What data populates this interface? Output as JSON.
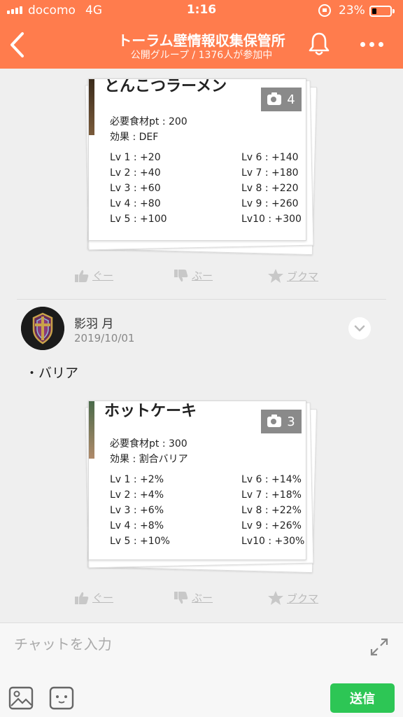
{
  "status_bar": {
    "carrier": "docomo",
    "network": "4G",
    "time": "1:16",
    "battery_percent": "23%",
    "battery_level": 0.23
  },
  "header": {
    "title": "トーラム壁情報収集保管所",
    "subtitle": "公開グループ / 1376人が参加中"
  },
  "posts": [
    {
      "card": {
        "title": "とんこつラーメン",
        "photo_count": "4",
        "required": "必要食材pt : 200",
        "effect": "効果 : DEF",
        "levels_left": [
          "Lv 1 : +20",
          "Lv 2 : +40",
          "Lv 3 : +60",
          "Lv 4 : +80",
          "Lv 5 : +100"
        ],
        "levels_right": [
          "Lv 6  : +140",
          "Lv 7  : +180",
          "Lv 8  : +220",
          "Lv 9  : +260",
          "Lv10 : +300"
        ]
      },
      "reactions": {
        "good": "ぐー",
        "bad": "ぶー",
        "bookmark": "ブクマ"
      }
    },
    {
      "author": "影羽 月",
      "date": "2019/10/01",
      "text": "・バリア",
      "card": {
        "title": "ホットケーキ",
        "photo_count": "3",
        "required": "必要食材pt : 300",
        "effect": "効果 : 割合バリア",
        "levels_left": [
          "Lv 1 : +2%",
          "Lv 2 : +4%",
          "Lv 3 : +6%",
          "Lv 4 : +8%",
          "Lv 5 : +10%"
        ],
        "levels_right": [
          "Lv 6  : +14%",
          "Lv 7  : +18%",
          "Lv 8  : +22%",
          "Lv 9  : +26%",
          "Lv10 : +30%"
        ]
      },
      "reactions": {
        "good": "ぐー",
        "bad": "ぶー",
        "bookmark": "ブクマ"
      }
    }
  ],
  "chat": {
    "placeholder": "チャットを入力",
    "send_label": "送信"
  },
  "colors": {
    "header_bg": "#ff7c4d",
    "send_bg": "#2dc655"
  }
}
